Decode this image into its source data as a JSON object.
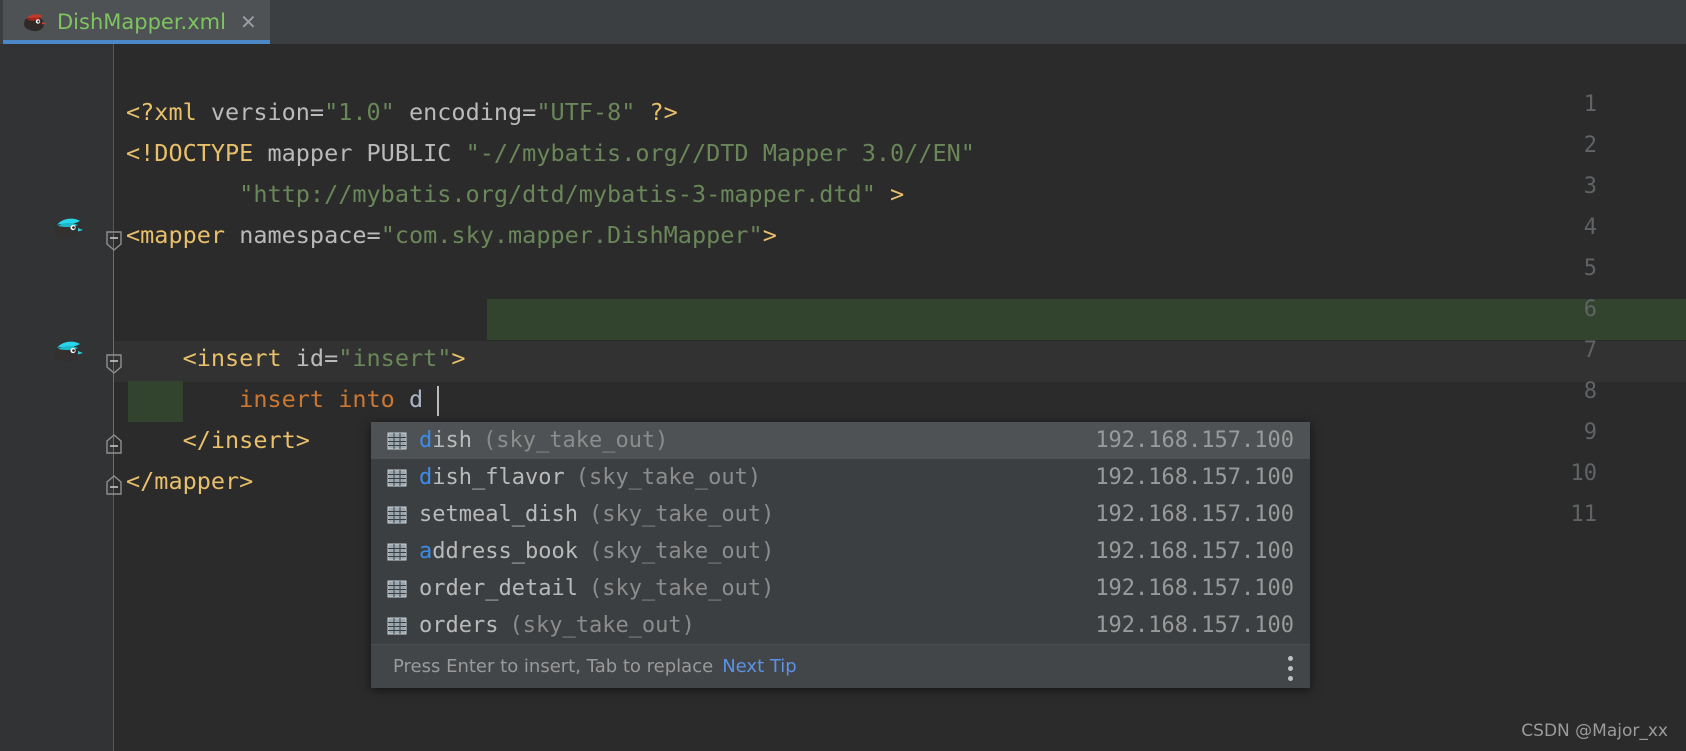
{
  "tab": {
    "label": "DishMapper.xml",
    "close_label": "✕",
    "icon": "mybatis-file-icon",
    "label_color": "#7ec45f",
    "underline_color": "#4a88c7"
  },
  "editor": {
    "background": "#2b2b2b",
    "gutter_background": "#313335",
    "line_numbers": [
      "1",
      "2",
      "3",
      "4",
      "5",
      "6",
      "7",
      "8",
      "9",
      "10",
      "11"
    ],
    "gutter_icons": [
      {
        "line": 4,
        "name": "mybatis-mapper-icon"
      },
      {
        "line": 7,
        "name": "mybatis-statement-icon"
      }
    ],
    "fold_markers": [
      {
        "line": 4,
        "type": "expanded-minus"
      },
      {
        "line": 7,
        "type": "expanded-minus"
      },
      {
        "line": 9,
        "type": "fold-end"
      },
      {
        "line": 10,
        "type": "fold-end"
      }
    ],
    "lines": [
      {
        "n": 1,
        "text": "<?xml version=\"1.0\" encoding=\"UTF-8\" ?>"
      },
      {
        "n": 2,
        "text": "<!DOCTYPE mapper PUBLIC \"-//mybatis.org//DTD Mapper 3.0//EN\""
      },
      {
        "n": 3,
        "text": "        \"http://mybatis.org/dtd/mybatis-3-mapper.dtd\" >"
      },
      {
        "n": 4,
        "text": "<mapper namespace=\"com.sky.mapper.DishMapper\">"
      },
      {
        "n": 5,
        "text": ""
      },
      {
        "n": 6,
        "text": ""
      },
      {
        "n": 7,
        "text": "    <insert id=\"insert\">"
      },
      {
        "n": 8,
        "text": "        insert into d"
      },
      {
        "n": 9,
        "text": "    </insert>"
      },
      {
        "n": 10,
        "text": "</mapper>"
      },
      {
        "n": 11,
        "text": ""
      }
    ],
    "tokens": {
      "l1_open": "<?xml",
      "l1_attr1": " version=",
      "l1_val1": "\"1.0\"",
      "l1_attr2": " encoding=",
      "l1_val2": "\"UTF-8\"",
      "l1_close": " ?>",
      "l2_doctype": "<!DOCTYPE",
      "l2_rest": " mapper PUBLIC ",
      "l2_str": "\"-//mybatis.org//DTD Mapper 3.0//EN\"",
      "l3_str": "        \"http://mybatis.org/dtd/mybatis-3-mapper.dtd\"",
      "l3_gt": " >",
      "l4_tag": "<mapper",
      "l4_attr": " namespace=",
      "l4_val": "\"com.sky.mapper.DishMapper\"",
      "l4_close": ">",
      "l7_tag": "    <insert",
      "l7_attr": " id=",
      "l7_val": "\"insert\"",
      "l7_close": ">",
      "l8_kw": "        insert into ",
      "l8_typed": "d",
      "l9_tag": "    </insert>",
      "l10_tag": "</mapper>"
    },
    "colors": {
      "tag": "#e8bf6a",
      "attribute": "#bababa",
      "string": "#6a8759",
      "sql_keyword": "#cc7832",
      "injection_highlight": "#33442e",
      "caret": "#bbbbbb",
      "error_squiggle": "#cc4040"
    }
  },
  "completion_popup": {
    "typed_prefix": "d",
    "items": [
      {
        "name_prefix": "d",
        "name_rest": "ish",
        "name_full": "dish",
        "schema": "(sky_take_out)",
        "host": "192.168.157.100",
        "selected": true,
        "icon": "table-icon"
      },
      {
        "name_prefix": "d",
        "name_rest": "ish_flavor",
        "name_full": "dish_flavor",
        "schema": "(sky_take_out)",
        "host": "192.168.157.100",
        "selected": false,
        "icon": "table-icon"
      },
      {
        "name_prefix": "setmeal_d",
        "name_rest": "ish",
        "name_full": "setmeal_dish",
        "schema": "(sky_take_out)",
        "host": "192.168.157.100",
        "selected": false,
        "icon": "table-icon"
      },
      {
        "name_prefix": "a",
        "name_rest": "ddress_book",
        "name_full": "address_book",
        "schema": "(sky_take_out)",
        "host": "192.168.157.100",
        "selected": false,
        "icon": "table-icon"
      },
      {
        "name_prefix": "or",
        "name_rest": "der_detail",
        "name_full": "order_detail",
        "schema": "(sky_take_out)",
        "host": "192.168.157.100",
        "selected": false,
        "icon": "table-icon"
      },
      {
        "name_prefix": "or",
        "name_rest": "ders",
        "name_full": "orders",
        "schema": "(sky_take_out)",
        "host": "192.168.157.100",
        "selected": false,
        "icon": "table-icon"
      }
    ],
    "hint": "Press Enter to insert, Tab to replace",
    "hint_link": "Next Tip",
    "menu_icon": "kebab-menu-icon",
    "match_color": "#3d8ce8",
    "selected_row_background": "#4e5254"
  },
  "watermark": {
    "text": "CSDN @Major_xx"
  }
}
